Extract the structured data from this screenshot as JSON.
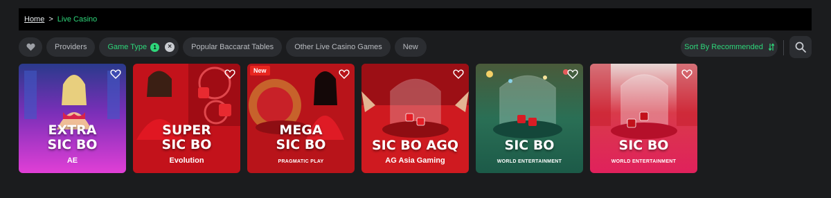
{
  "breadcrumb": {
    "home": "Home",
    "separator": ">",
    "current": "Live Casino"
  },
  "filters": {
    "providers": "Providers",
    "game_type": "Game Type",
    "game_type_count": "1",
    "popular_baccarat": "Popular Baccarat Tables",
    "other_live": "Other Live Casino Games",
    "new": "New"
  },
  "sort": {
    "label": "Sort By Recommended"
  },
  "colors": {
    "accent": "#2ed67a",
    "chip_bg": "#2b2d31",
    "bar_bg": "#000000",
    "page_bg": "#1b1c1e"
  },
  "games": [
    {
      "title": "EXTRA\nSIC BO",
      "provider": "AE",
      "tag": ""
    },
    {
      "title": "SUPER\nSIC BO",
      "provider": "Evolution",
      "tag": ""
    },
    {
      "title": "MEGA\nSIC BO",
      "provider": "PRAGMATIC PLAY",
      "tag": "New"
    },
    {
      "title": "SIC BO AGQ",
      "provider": "AG Asia Gaming",
      "tag": ""
    },
    {
      "title": "SIC BO",
      "provider": "WORLD ENTERTAINMENT",
      "tag": ""
    },
    {
      "title": "SIC BO",
      "provider": "WORLD ENTERTAINMENT",
      "tag": ""
    }
  ]
}
